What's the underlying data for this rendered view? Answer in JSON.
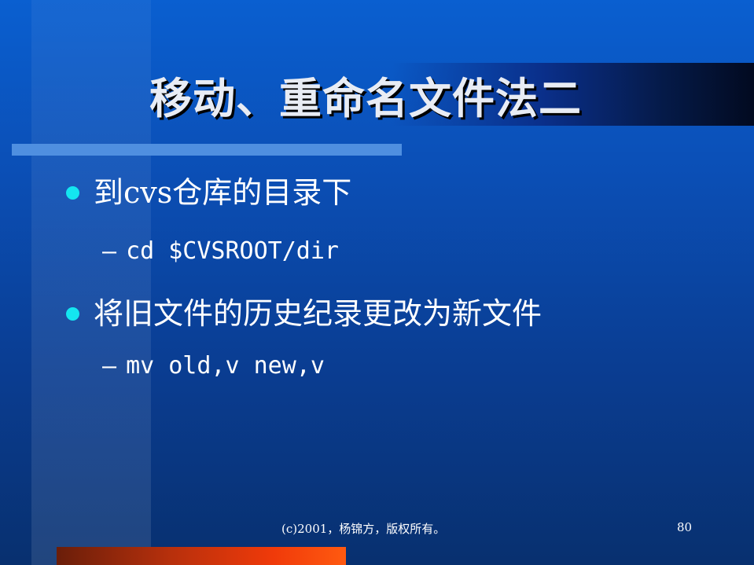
{
  "slide": {
    "title": "移动、重命名文件法二",
    "bullets": [
      {
        "text": "到cvs仓库的目录下",
        "sub": [
          {
            "dash": "–",
            "text": "cd $CVSROOT/dir"
          }
        ]
      },
      {
        "text": "将旧文件的历史纪录更改为新文件",
        "sub": [
          {
            "dash": "–",
            "text": "mv old,v new,v"
          }
        ]
      }
    ],
    "footer": "(c)2001，杨锦方，版权所有。",
    "page_number": "80"
  },
  "colors": {
    "background_top": "#0a5fd0",
    "background_bottom": "#08306f",
    "bullet": "#14e6f0",
    "accent_bar": "#4f8fe0",
    "bottom_bar": "#f03a0a"
  }
}
